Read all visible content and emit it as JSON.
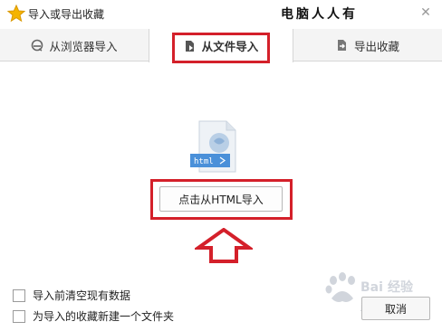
{
  "window": {
    "title": "导入或导出收藏",
    "close_glyph": "✕"
  },
  "watermark": {
    "caption": "电脑人人有",
    "logo": "baidu-jingyan-logo"
  },
  "tabs": [
    {
      "label": "从浏览器导入",
      "icon": "browser-import-icon",
      "selected": false
    },
    {
      "label": "从文件导入",
      "icon": "file-import-icon",
      "selected": true
    },
    {
      "label": "导出收藏",
      "icon": "export-icon",
      "selected": false
    }
  ],
  "file_icon": {
    "badge": "html",
    "icon": "html-file-icon"
  },
  "import_button": {
    "label": "点击从HTML导入"
  },
  "options": [
    {
      "label": "导入前清空现有数据",
      "checked": false
    },
    {
      "label": "为导入的收藏新建一个文件夹",
      "checked": false
    }
  ],
  "cancel_button": {
    "label": "取消"
  },
  "colors": {
    "annotation_red": "#d4202a",
    "star_yellow": "#f5b400",
    "file_blue": "#4a90d9"
  }
}
